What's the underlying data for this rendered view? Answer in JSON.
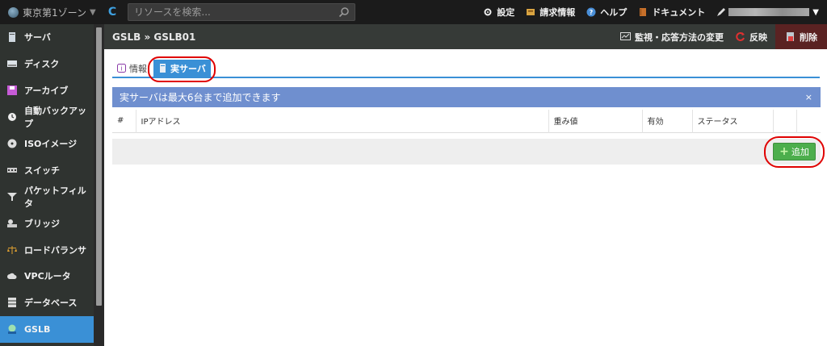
{
  "topbar": {
    "zone": "東京第1ゾーン",
    "search_placeholder": "リソースを検索...",
    "nav": [
      "設定",
      "請求情報",
      "ヘルプ",
      "ドキュメント"
    ]
  },
  "sidebar": {
    "items": [
      "サーバ",
      "ディスク",
      "アーカイブ",
      "自動バックアップ",
      "ISOイメージ",
      "スイッチ",
      "パケットフィルタ",
      "ブリッジ",
      "ロードバランサ",
      "VPCルータ",
      "データベース",
      "GSLB"
    ],
    "active": "GSLB"
  },
  "header": {
    "breadcrumb": "GSLB » GSLB01",
    "actions": {
      "monitor": "監視・応答方法の変更",
      "reflect": "反映",
      "delete": "削除"
    }
  },
  "tabs": {
    "info": "情報",
    "real_server": "実サーバ"
  },
  "alert": {
    "message": "実サーバは最大6台まで追加できます",
    "close": "×"
  },
  "table": {
    "columns": [
      "#",
      "IPアドレス",
      "重み値",
      "有効",
      "ステータス",
      ""
    ]
  },
  "add_button": "追加",
  "colors": {
    "accent": "#3a90d6",
    "alert": "#6f8fcf",
    "add": "#4cae4c",
    "highlight": "#e00000"
  }
}
